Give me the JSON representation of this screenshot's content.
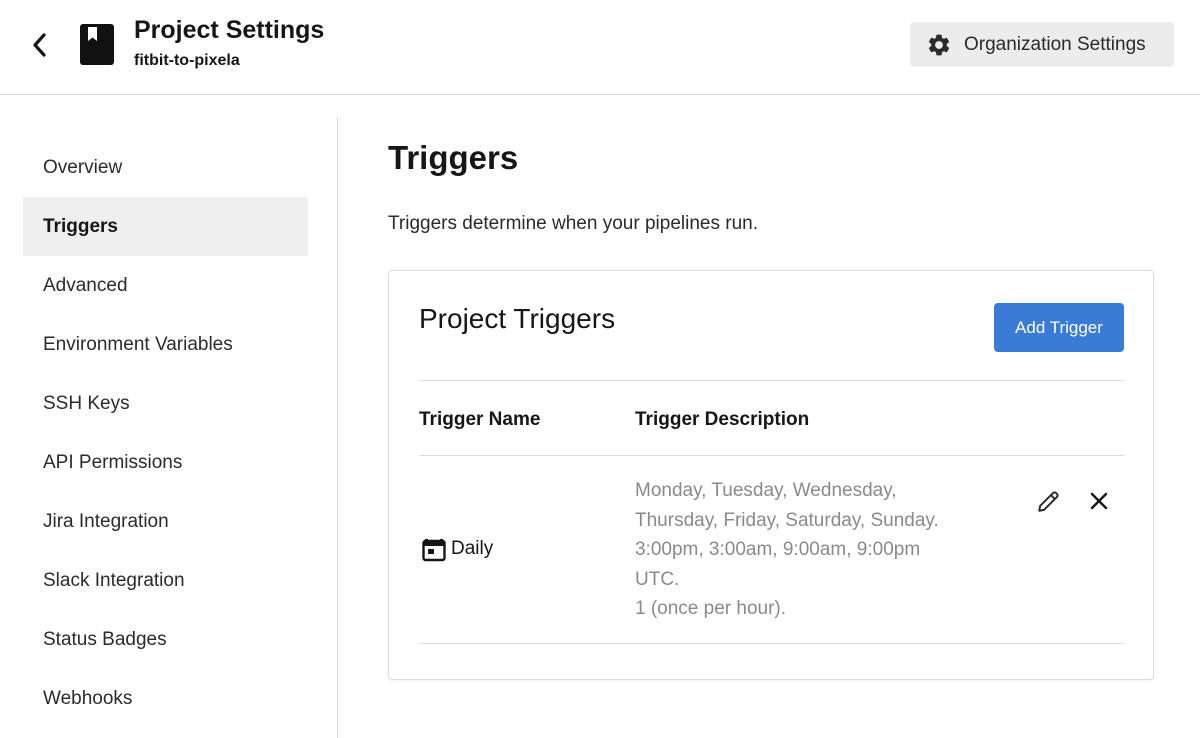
{
  "header": {
    "title": "Project Settings",
    "subtitle": "fitbit-to-pixela",
    "org_settings_label": "Organization Settings"
  },
  "sidebar": {
    "items": [
      {
        "label": "Overview",
        "active": false
      },
      {
        "label": "Triggers",
        "active": true
      },
      {
        "label": "Advanced",
        "active": false
      },
      {
        "label": "Environment Variables",
        "active": false
      },
      {
        "label": "SSH Keys",
        "active": false
      },
      {
        "label": "API Permissions",
        "active": false
      },
      {
        "label": "Jira Integration",
        "active": false
      },
      {
        "label": "Slack Integration",
        "active": false
      },
      {
        "label": "Status Badges",
        "active": false
      },
      {
        "label": "Webhooks",
        "active": false
      }
    ]
  },
  "main": {
    "title": "Triggers",
    "description": "Triggers determine when your pipelines run.",
    "card": {
      "title": "Project Triggers",
      "add_button_label": "Add Trigger",
      "columns": [
        "Trigger Name",
        "Trigger Description"
      ],
      "rows": [
        {
          "name": "Daily",
          "icon": "calendar-icon",
          "description_lines": [
            "Monday, Tuesday, Wednesday,",
            "Thursday, Friday, Saturday, Sunday.",
            "3:00pm, 3:00am, 9:00am, 9:00pm",
            "UTC.",
            "1 (once per hour)."
          ]
        }
      ]
    }
  },
  "colors": {
    "accent": "#3a7bd5",
    "active_bg": "#efefef",
    "muted_text": "#8a8a8a",
    "button_bg": "#ececec"
  }
}
